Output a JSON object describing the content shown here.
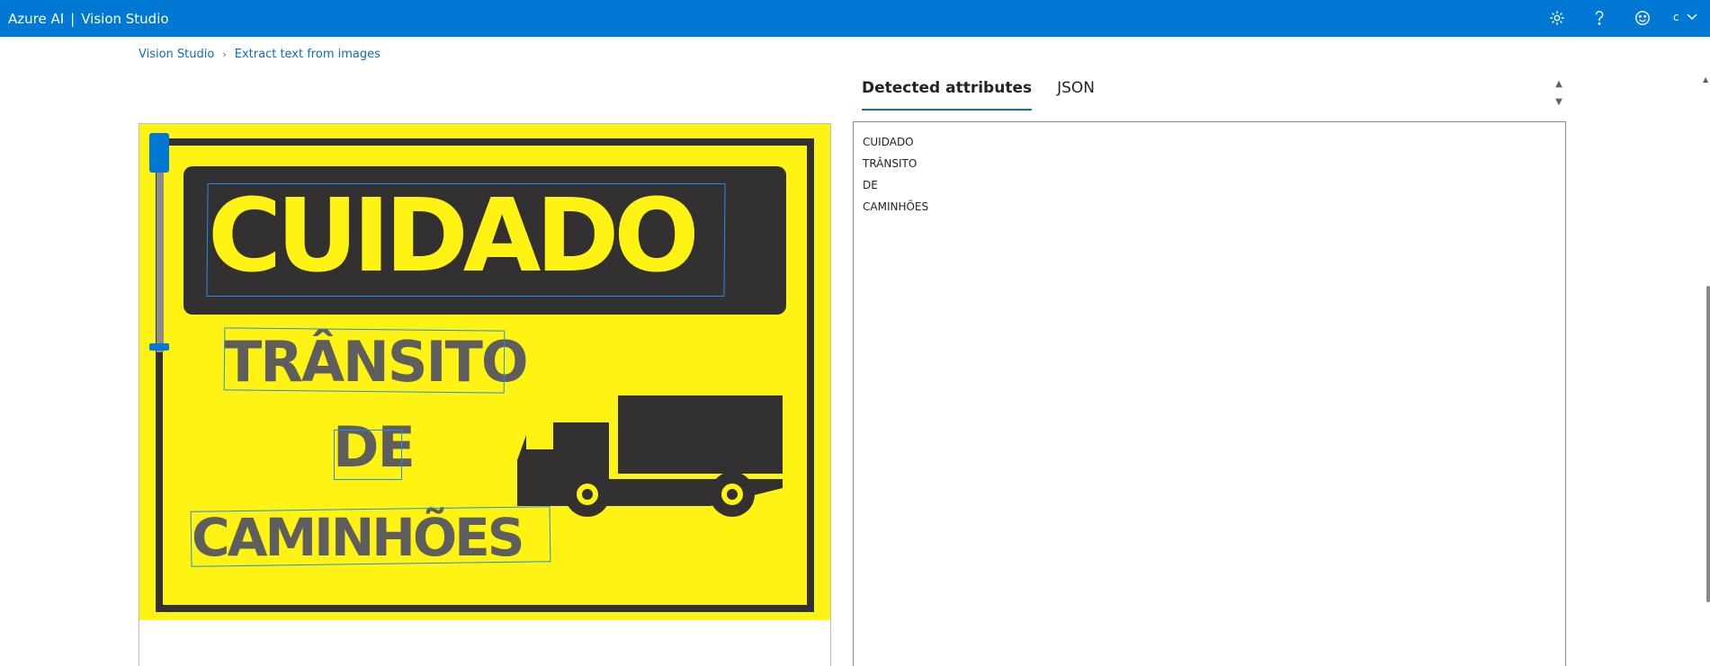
{
  "header": {
    "product": "Azure AI",
    "separator": "|",
    "app": "Vision Studio",
    "user_initial": "c",
    "icons": [
      "settings-icon",
      "help-icon",
      "feedback-icon"
    ]
  },
  "breadcrumb": {
    "root": "Vision Studio",
    "current": "Extract text from images"
  },
  "tabs": [
    {
      "label": "Detected attributes",
      "active": true
    },
    {
      "label": "JSON",
      "active": false
    }
  ],
  "results": {
    "lines": [
      "CUIDADO",
      "TRÂNSITO",
      "DE",
      "CAMINHÕES"
    ]
  },
  "image": {
    "line1": "CUIDADO",
    "line2": "TRÂNSITO",
    "line3": "DE",
    "line4": "CAMINHÕES",
    "background_color": "#fff314",
    "text_color": "#5e5e5e",
    "box_color": "#1f8ee6"
  },
  "colors": {
    "accent": "#0078d4",
    "link": "#0f6cbd"
  }
}
